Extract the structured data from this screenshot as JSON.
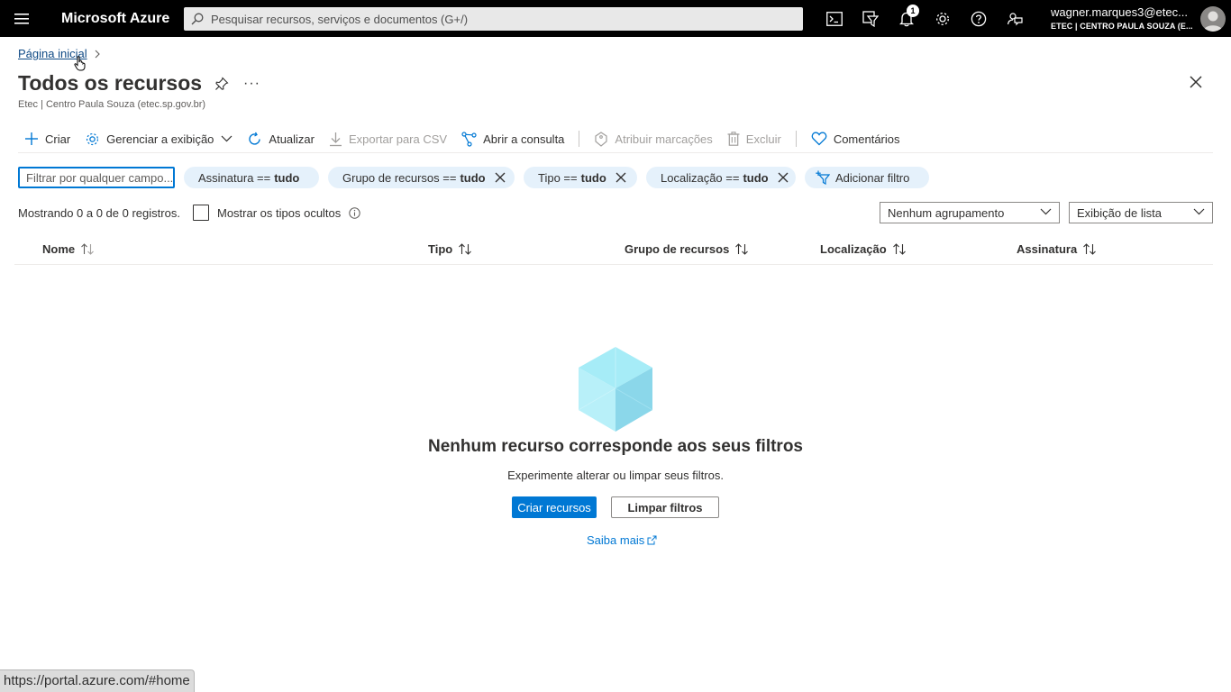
{
  "topbar": {
    "brand": "Microsoft Azure",
    "search_placeholder": "Pesquisar recursos, serviços e documentos (G+/)",
    "notification_count": "1",
    "account_name": "wagner.marques3@etec...",
    "account_tenant": "ETEC | CENTRO PAULA SOUZA (E...",
    "background": "#000000"
  },
  "breadcrumb": {
    "home": "Página inicial"
  },
  "page": {
    "title": "Todos os recursos",
    "subtitle": "Etec | Centro Paula Souza (etec.sp.gov.br)",
    "more": "···"
  },
  "toolbar": {
    "create": "Criar",
    "manage_view": "Gerenciar a exibição",
    "refresh": "Atualizar",
    "export_csv": "Exportar para CSV",
    "open_query": "Abrir a consulta",
    "assign_tags": "Atribuir marcações",
    "delete": "Excluir",
    "feedback": "Comentários"
  },
  "filters": {
    "input_placeholder": "Filtrar por qualquer campo...",
    "subscription_label": "Assinatura ==",
    "subscription_value": "tudo",
    "resource_group_label": "Grupo de recursos ==",
    "resource_group_value": "tudo",
    "type_label": "Tipo ==",
    "type_value": "tudo",
    "location_label": "Localização ==",
    "location_value": "tudo",
    "add_filter": "Adicionar filtro"
  },
  "list_controls": {
    "records_text": "Mostrando 0 a 0 de 0 registros.",
    "show_hidden_types": "Mostrar os tipos ocultos",
    "show_hidden_checked": false,
    "grouping_value": "Nenhum agrupamento",
    "view_value": "Exibição de lista"
  },
  "table": {
    "columns": [
      "Nome",
      "Tipo",
      "Grupo de recursos",
      "Localização",
      "Assinatura"
    ],
    "rows": []
  },
  "empty_state": {
    "title": "Nenhum recurso corresponde aos seus filtros",
    "subtitle": "Experimente alterar ou limpar seus filtros.",
    "create_button": "Criar recursos",
    "clear_button": "Limpar filtros",
    "learn_more": "Saiba mais"
  },
  "status_bar": {
    "url": "https://portal.azure.com/#home"
  },
  "colors": {
    "accent": "#0078d4",
    "pill": "#e5f1fb",
    "link": "#0f4a85"
  }
}
